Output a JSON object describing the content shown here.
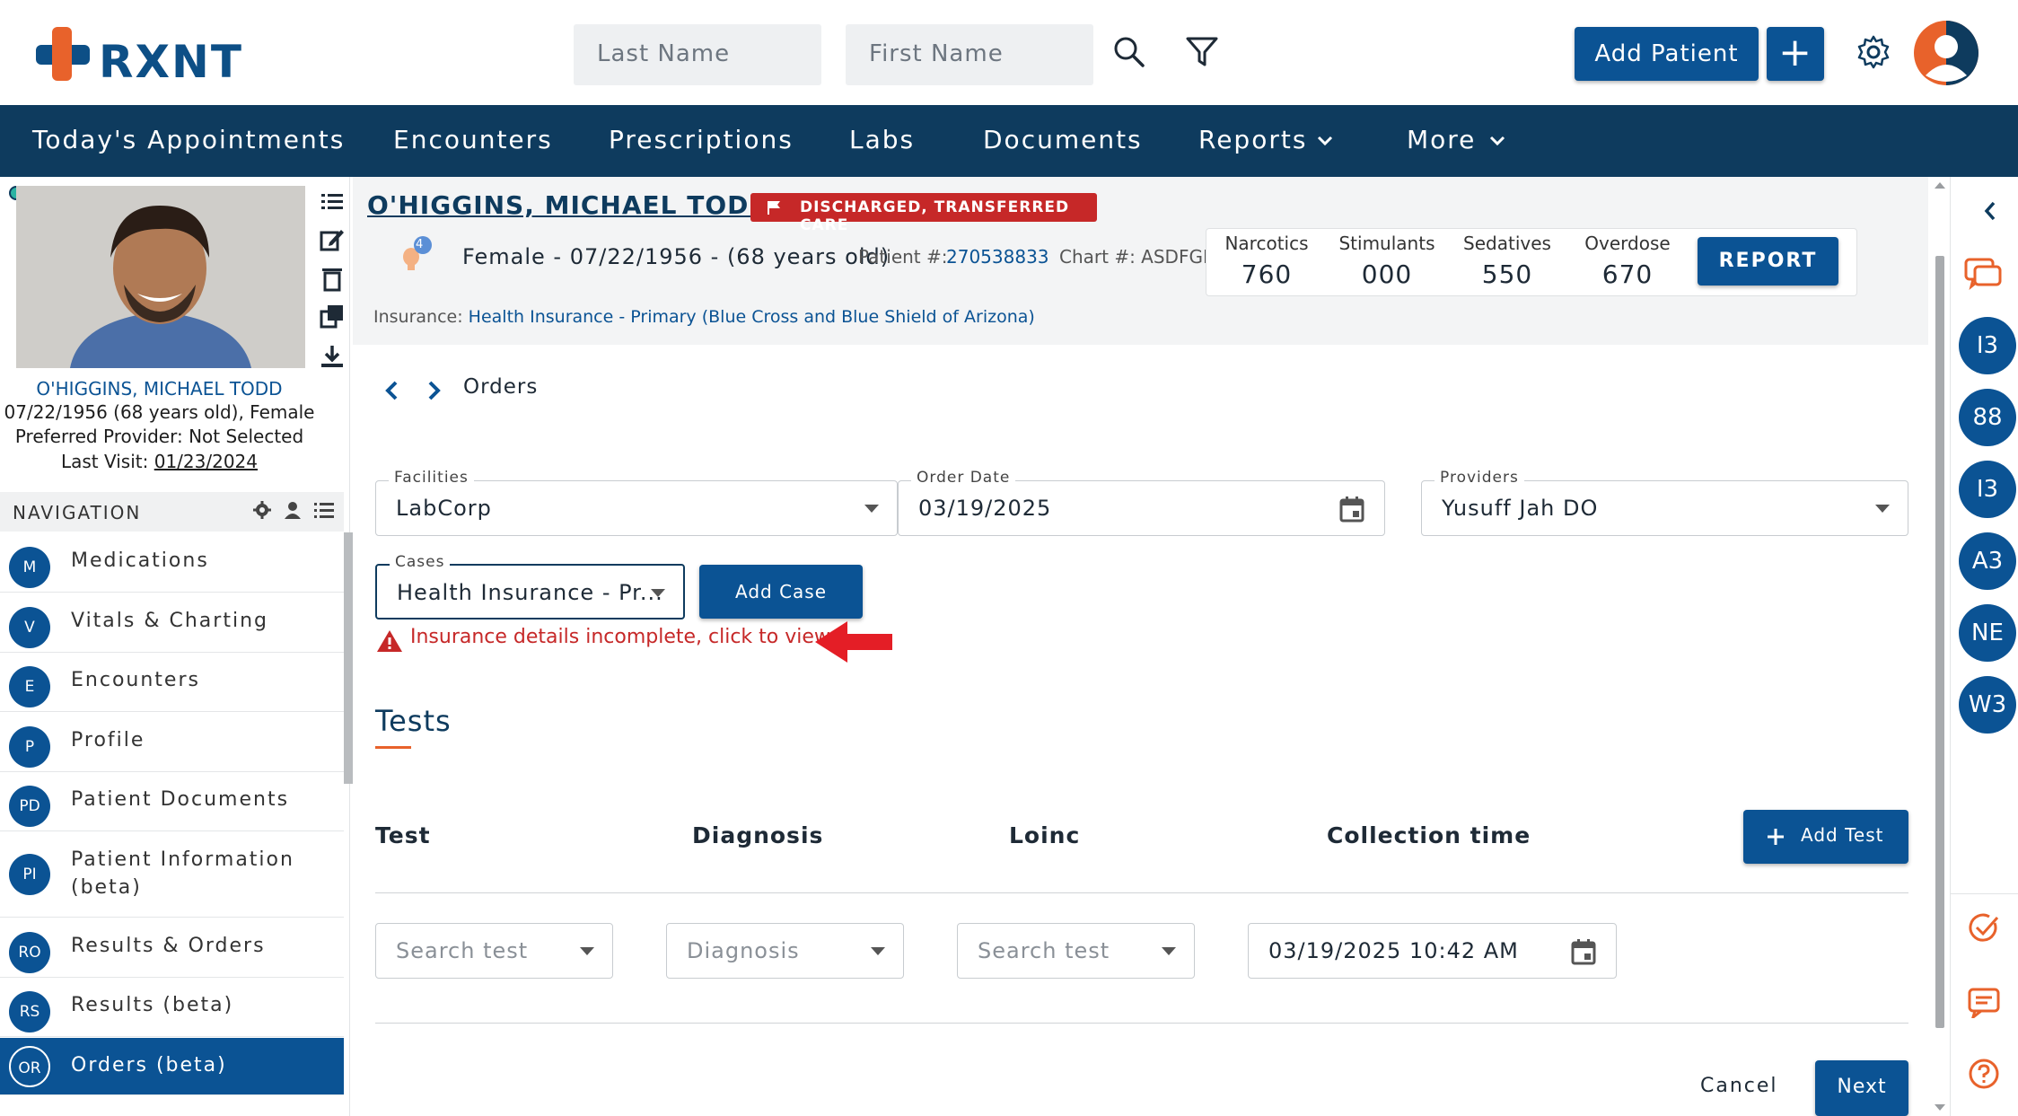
{
  "header": {
    "logo_text": "RXNT",
    "search_last_placeholder": "Last Name",
    "search_first_placeholder": "First Name",
    "add_patient_label": "Add Patient",
    "add_button_glyph": "+",
    "icons": [
      "search-icon",
      "filter-icon",
      "gear-icon",
      "user-avatar-icon"
    ],
    "brand_colors": {
      "primary": "#0b5394",
      "nav": "#0e3b5e",
      "accent": "#e8622b",
      "alert": "#c62828"
    }
  },
  "mainnav": {
    "items": [
      {
        "label": "Today's Appointments"
      },
      {
        "label": "Encounters"
      },
      {
        "label": "Prescriptions"
      },
      {
        "label": "Labs"
      },
      {
        "label": "Documents"
      },
      {
        "label": "Reports"
      },
      {
        "label": "More"
      }
    ]
  },
  "leftpanel": {
    "patient_name": "O'HIGGINS, MICHAEL TODD",
    "dob_line": "07/22/1956 (68 years old), Female",
    "provider_line": "Preferred Provider: Not Selected",
    "last_visit_label": "Last Visit:",
    "last_visit_date": "01/23/2024",
    "navigation_title": "NAVIGATION",
    "nav_items": [
      {
        "abbr": "M",
        "label": "Medications"
      },
      {
        "abbr": "V",
        "label": "Vitals & Charting"
      },
      {
        "abbr": "E",
        "label": "Encounters"
      },
      {
        "abbr": "P",
        "label": "Profile"
      },
      {
        "abbr": "PD",
        "label": "Patient Documents"
      },
      {
        "abbr": "PI",
        "label": "Patient Information",
        "label2": "(beta)"
      },
      {
        "abbr": "RO",
        "label": "Results & Orders"
      },
      {
        "abbr": "RS",
        "label": "Results (beta)"
      },
      {
        "abbr": "OR",
        "label": "Orders (beta)",
        "active": true
      }
    ]
  },
  "patient_header": {
    "name": "O'HIGGINS, MICHAEL TODD",
    "status_badge": "DISCHARGED, TRANSFERRED CARE",
    "alert_count": "4",
    "demographics": "Female - 07/22/1956 - (68 years old)",
    "patient_num_label": "Patient #:",
    "patient_num": "270538833",
    "chart_label": "Chart #: ASDFGH",
    "insurance_label": "Insurance:",
    "insurance_value": "Health Insurance - Primary (Blue Cross and Blue Shield of Arizona)",
    "scores": [
      {
        "label": "Narcotics",
        "value": "760"
      },
      {
        "label": "Stimulants",
        "value": "000"
      },
      {
        "label": "Sedatives",
        "value": "550"
      },
      {
        "label": "Overdose",
        "value": "670"
      }
    ],
    "report_label": "REPORT"
  },
  "main": {
    "breadcrumb": "Orders",
    "facilities_label": "Facilities",
    "facilities_value": "LabCorp",
    "order_date_label": "Order Date",
    "order_date_value": "03/19/2025",
    "providers_label": "Providers",
    "providers_value": "Yusuff Jah DO",
    "cases_label": "Cases",
    "cases_value": "Health Insurance - Pr...",
    "add_case_label": "Add Case",
    "warning_text": "Insurance details incomplete, click to view",
    "tests_title": "Tests",
    "columns": [
      "Test",
      "Diagnosis",
      "Loinc",
      "Collection time"
    ],
    "add_test_label": "Add Test",
    "row": {
      "test_placeholder": "Search test",
      "diagnosis_placeholder": "Diagnosis",
      "loinc_placeholder": "Search test",
      "collection_time": "03/19/2025 10:42 AM"
    },
    "cancel_label": "Cancel",
    "next_label": "Next"
  },
  "rightrail": {
    "circles": [
      "I3",
      "88",
      "I3",
      "A3",
      "NE",
      "W3"
    ]
  }
}
